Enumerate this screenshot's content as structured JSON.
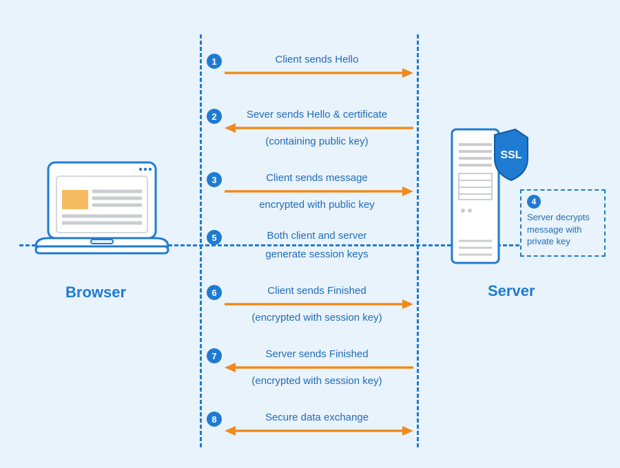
{
  "labels": {
    "browser": "Browser",
    "server": "Server",
    "ssl": "SSL"
  },
  "steps": {
    "s1": {
      "num": "1",
      "text": "Client sends Hello"
    },
    "s2": {
      "num": "2",
      "line1": "Sever sends Hello & certificate",
      "line2": "(containing public key)"
    },
    "s3": {
      "num": "3",
      "line1": "Client sends message",
      "line2": "encrypted with public key"
    },
    "s4": {
      "num": "4",
      "text": "Server decrypts message with private key"
    },
    "s5": {
      "num": "5",
      "line1": "Both client and server",
      "line2": "generate session keys"
    },
    "s6": {
      "num": "6",
      "line1": "Client sends Finished",
      "line2": "(encrypted with session key)"
    },
    "s7": {
      "num": "7",
      "line1": "Server sends Finished",
      "line2": "(encrypted with session key)"
    },
    "s8": {
      "num": "8",
      "text": "Secure data exchange"
    }
  },
  "colors": {
    "bg": "#e9f3fc",
    "blue": "#1f7bd1",
    "orange": "#f08a1d"
  }
}
